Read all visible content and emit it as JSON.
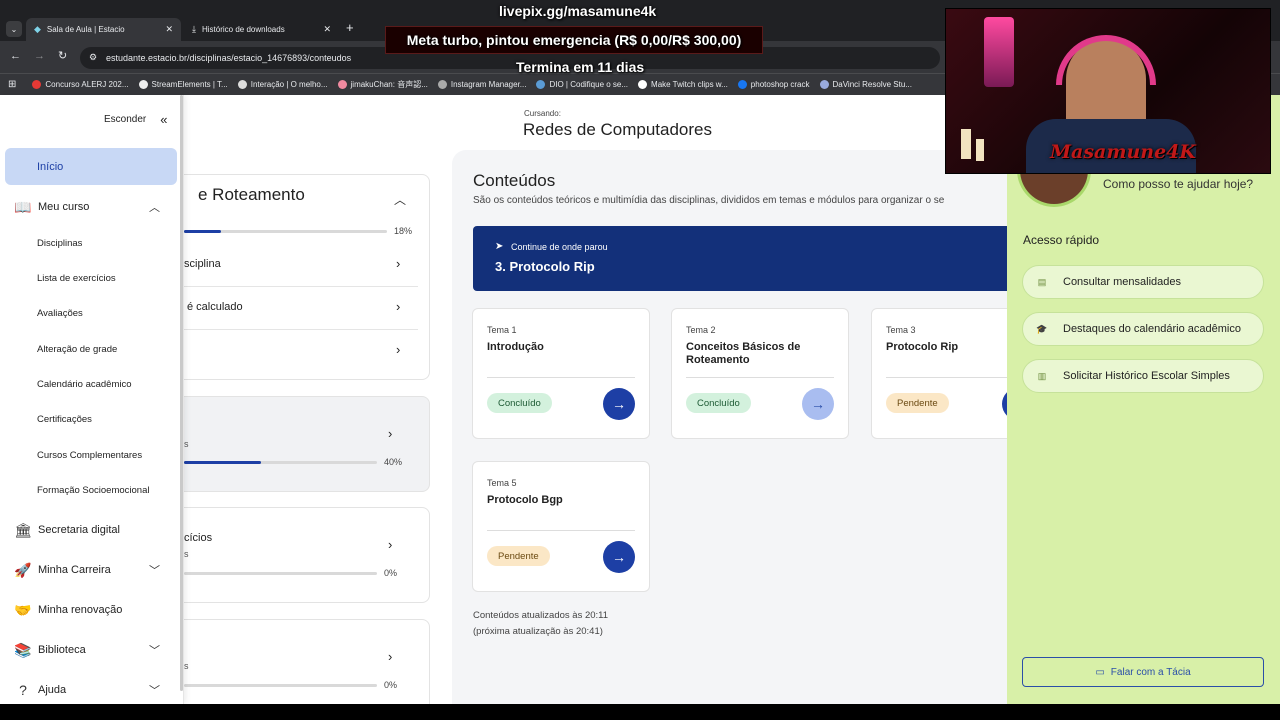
{
  "browser": {
    "tabs": [
      {
        "label": "Sala de Aula | Estacio"
      },
      {
        "label": "Histórico de downloads"
      }
    ],
    "url": "estudante.estacio.br/disciplinas/estacio_14676893/conteudos",
    "bookmarks": [
      "Concurso ALERJ 202...",
      "StreamElements | T...",
      "Interação | O melho...",
      "jimakuChan: 音声認...",
      "Instagram Manager...",
      "DIO | Codifique o se...",
      "Make Twitch clips w...",
      "photoshop crack",
      "DaVinci Resolve Stu..."
    ]
  },
  "overlays": {
    "pix": "livepix.gg/masamune4k",
    "goal": "Meta turbo, pintou emergencia (R$ 0,00/R$ 300,00)",
    "ends": "Termina em 11 dias",
    "webcam_name": "Masamune4K"
  },
  "sidebar": {
    "hide": "Esconder",
    "inicio": "Início",
    "meu_curso": "Meu curso",
    "sub": [
      "Disciplinas",
      "Lista de exercícios",
      "Avaliações",
      "Alteração de grade",
      "Calendário acadêmico",
      "Certificações",
      "Cursos Complementares",
      "Formação Socioemocional"
    ],
    "secretaria": "Secretaria digital",
    "carreira": "Minha Carreira",
    "renovacao": "Minha renovação",
    "biblioteca": "Biblioteca",
    "ajuda": "Ajuda"
  },
  "header": {
    "label": "Cursando:",
    "course": "Redes de Computadores"
  },
  "left_panel": {
    "card_title": "e Roteamento",
    "progress_pct": "18%",
    "progress": 0.18,
    "row1": "sciplina",
    "row2": "é calculado",
    "card2_pct": "40%",
    "card2_sub": "s",
    "card2_progress": 0.4,
    "card3_title": "cícios",
    "card3_sub": "s",
    "card3_pct": "0%",
    "card4_sub": "s",
    "card4_pct": "0%"
  },
  "content": {
    "title": "Conteúdos",
    "desc": "São os conteúdos teóricos e multimídia das disciplinas, divididos em temas e módulos para organizar o se",
    "continue_label": "Continue de onde parou",
    "continue_title": "3. Protocolo Rip",
    "themes": [
      {
        "num": "Tema 1",
        "title": "Introdução",
        "status": "Concluído"
      },
      {
        "num": "Tema 2",
        "title": "Conceitos Básicos de Roteamento",
        "status": "Concluído"
      },
      {
        "num": "Tema 3",
        "title": "Protocolo Rip",
        "status": "Pendente"
      },
      {
        "num": "Tema 5",
        "title": "Protocolo Bgp",
        "status": "Pendente"
      }
    ],
    "updated": "Conteúdos atualizados às 20:11",
    "next_update": "(próxima atualização às 20:41)"
  },
  "assistant": {
    "greeting": "Como posso te ajudar hoje?",
    "quick_title": "Acesso rápido",
    "quick": [
      "Consultar mensalidades",
      "Destaques do calendário acadêmico",
      "Solicitar Histórico Escolar Simples"
    ],
    "talk": "Falar com a Tácia"
  }
}
